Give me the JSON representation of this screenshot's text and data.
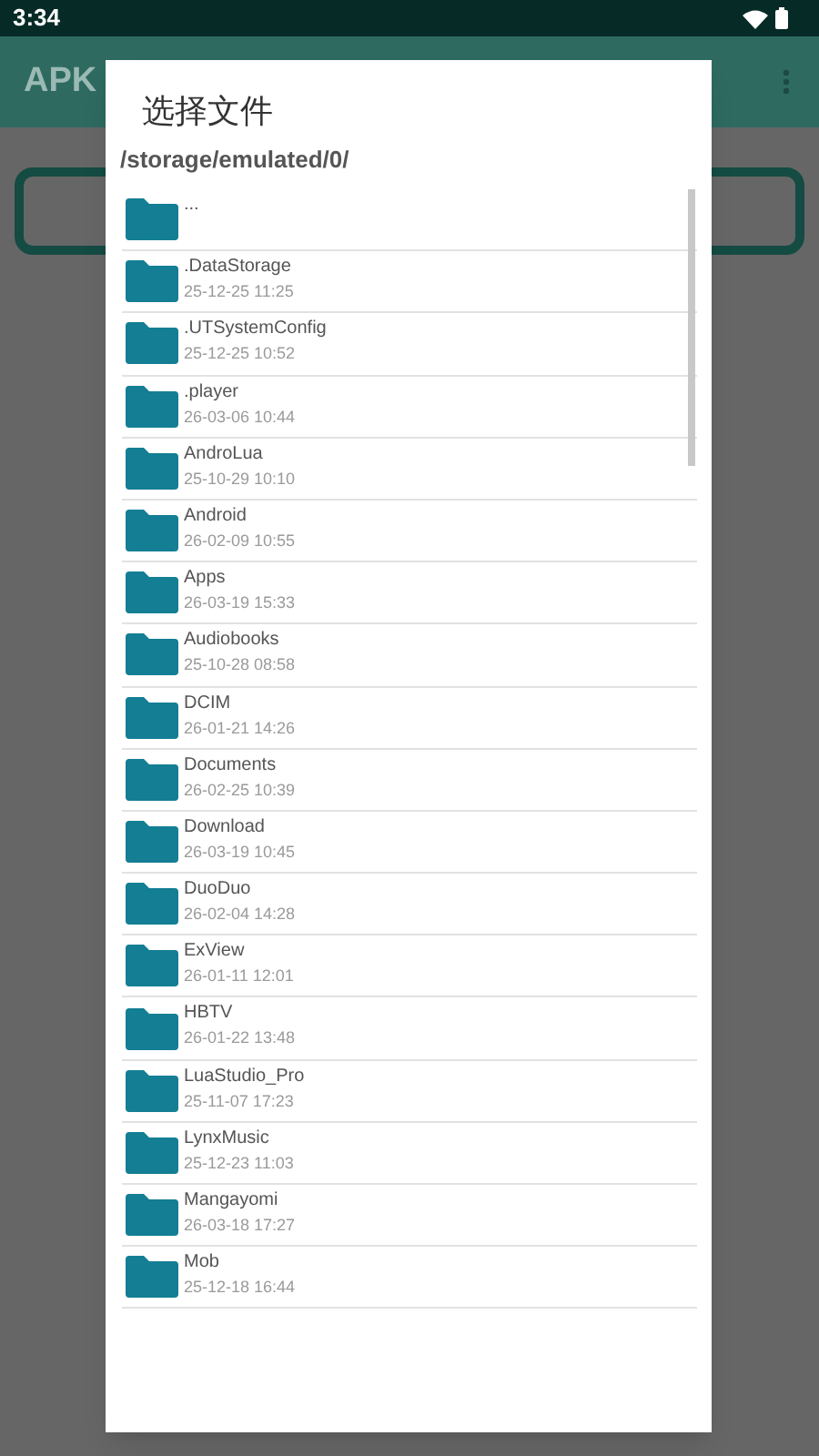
{
  "status_bar": {
    "time": "3:34"
  },
  "app_bar": {
    "title": "APK"
  },
  "dialog": {
    "title": "选择文件",
    "path": "/storage/emulated/0/",
    "items": [
      {
        "name": "..."
      },
      {
        "name": ".DataStorage",
        "date": "25-12-25 11:25"
      },
      {
        "name": ".UTSystemConfig",
        "date": "25-12-25 10:52"
      },
      {
        "name": ".player",
        "date": "26-03-06 10:44"
      },
      {
        "name": "AndroLua",
        "date": "25-10-29 10:10"
      },
      {
        "name": "Android",
        "date": "26-02-09 10:55"
      },
      {
        "name": "Apps",
        "date": "26-03-19 15:33"
      },
      {
        "name": "Audiobooks",
        "date": "25-10-28 08:58"
      },
      {
        "name": "DCIM",
        "date": "26-01-21 14:26"
      },
      {
        "name": "Documents",
        "date": "26-02-25 10:39"
      },
      {
        "name": "Download",
        "date": "26-03-19 10:45"
      },
      {
        "name": "DuoDuo",
        "date": "26-02-04 14:28"
      },
      {
        "name": "ExView",
        "date": "26-01-11 12:01"
      },
      {
        "name": "HBTV",
        "date": "26-01-22 13:48"
      },
      {
        "name": "LuaStudio_Pro",
        "date": "25-11-07 17:23"
      },
      {
        "name": "LynxMusic",
        "date": "25-12-23 11:03"
      },
      {
        "name": "Mangayomi",
        "date": "26-03-18 17:27"
      },
      {
        "name": "Mob",
        "date": "25-12-18 16:44"
      }
    ]
  }
}
